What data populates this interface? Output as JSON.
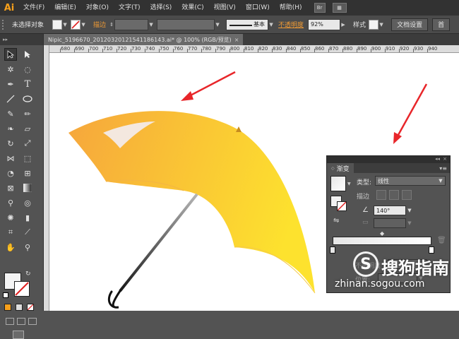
{
  "app": {
    "logo": "Ai"
  },
  "menu": {
    "items": [
      "文件(F)",
      "编辑(E)",
      "对象(O)",
      "文字(T)",
      "选择(S)",
      "效果(C)",
      "视图(V)",
      "窗口(W)",
      "帮助(H)"
    ],
    "bridge_label": "Br"
  },
  "control_bar": {
    "selection_status": "未选择对象",
    "stroke_label": "描边",
    "stroke_style": "基本",
    "opacity_label": "不透明度",
    "opacity_value": "92%",
    "style_label": "样式",
    "doc_settings_button": "文档设置",
    "truncated_button": "首"
  },
  "document_tab": {
    "title": "Nipic_5196670_20120320121541186143.ai* @ 100% (RGB/预览)",
    "close": "×"
  },
  "ruler": {
    "labels": [
      "680",
      "690",
      "700",
      "710",
      "720",
      "730",
      "740",
      "750",
      "760",
      "770",
      "780",
      "790",
      "800",
      "810",
      "820",
      "830",
      "840",
      "850",
      "860",
      "870",
      "880",
      "890",
      "900",
      "910",
      "920",
      "930",
      "940"
    ]
  },
  "gradient_panel": {
    "tab_label": "渐变",
    "type_label": "类型:",
    "type_value": "线性",
    "stroke_label": "描边",
    "angle_value": "140°",
    "location_label": "位置:",
    "opacity_label": "不透明度"
  },
  "watermark": {
    "logo_char": "S",
    "text": "搜狗指南",
    "url": "zhinan.sogou.com"
  },
  "colors": {
    "umbrella_start": "#f6a63c",
    "umbrella_end": "#fde22e",
    "arrow": "#e8262a",
    "accent_orange": "#ef9a34"
  }
}
